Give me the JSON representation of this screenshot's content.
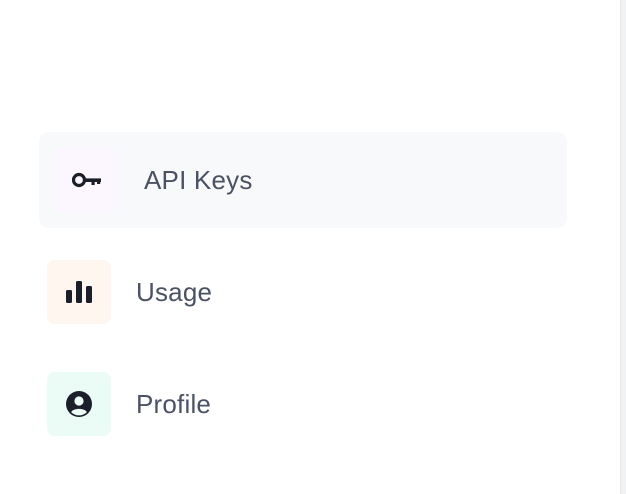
{
  "nav": {
    "items": [
      {
        "label": "API Keys",
        "icon": "key-icon",
        "icon_bg": "#fbf6ff",
        "active": true
      },
      {
        "label": "Usage",
        "icon": "bar-chart-icon",
        "icon_bg": "#fff7ef",
        "active": false
      },
      {
        "label": "Profile",
        "icon": "user-circle-icon",
        "icon_bg": "#ebfcf7",
        "active": false
      }
    ]
  },
  "colors": {
    "label": "#4b5263",
    "icon": "#1b1f2a",
    "active_bg": "#f8f9fb"
  }
}
